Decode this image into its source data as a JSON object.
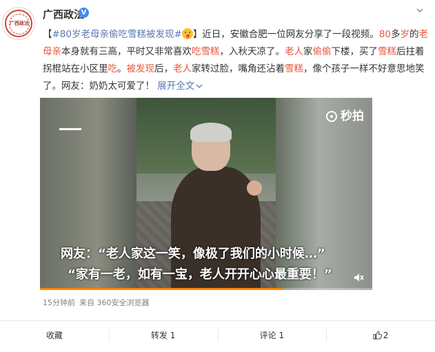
{
  "author": {
    "name": "广西政法",
    "verified": "V",
    "avatar_text": "广西政法"
  },
  "post": {
    "topic": "#80岁老母亲偷吃雪糕被发现#",
    "body_parts": [
      {
        "t": "【",
        "c": ""
      },
      {
        "t": "#80岁老母亲偷吃雪糕被发现#",
        "c": "topic"
      },
      {
        "t": "EMOJI",
        "c": "emoji"
      },
      {
        "t": "】近日，安徽合肥一位网友分享了一段视频。",
        "c": ""
      },
      {
        "t": "80",
        "c": "hl"
      },
      {
        "t": "多",
        "c": ""
      },
      {
        "t": "岁",
        "c": "hl"
      },
      {
        "t": "的",
        "c": ""
      },
      {
        "t": "老母亲",
        "c": "hl"
      },
      {
        "t": "本身就有三高，平时又非常喜欢",
        "c": ""
      },
      {
        "t": "吃雪糕",
        "c": "hl"
      },
      {
        "t": "，入秋天凉了。",
        "c": ""
      },
      {
        "t": "老人",
        "c": "hl"
      },
      {
        "t": "家",
        "c": ""
      },
      {
        "t": "偷偷",
        "c": "hl"
      },
      {
        "t": "下楼，买了",
        "c": ""
      },
      {
        "t": "雪糕",
        "c": "hl"
      },
      {
        "t": "后拄着拐棍站在小区里",
        "c": ""
      },
      {
        "t": "吃",
        "c": "hl"
      },
      {
        "t": "。",
        "c": ""
      },
      {
        "t": "被发现",
        "c": "hl"
      },
      {
        "t": "后，",
        "c": ""
      },
      {
        "t": "老人",
        "c": "hl"
      },
      {
        "t": "家转过脸，嘴角还沾着",
        "c": ""
      },
      {
        "t": "雪糕",
        "c": "hl"
      },
      {
        "t": "，像个孩子一样不好意思地笑了。网友：奶奶太可爱了！ ",
        "c": ""
      }
    ],
    "expand_label": "展开全文",
    "colors": {
      "highlight": "#e8583f",
      "link": "#5d79b3"
    }
  },
  "video": {
    "watermark": "秒拍",
    "caption_line1": "网友：“老人家这一笑，像极了我们的小时候…”",
    "caption_line2": "“家有一老，如有一宝，老人开开心心最重要！”",
    "progress": 0.73,
    "progress_color": "#ff8200"
  },
  "meta": {
    "time": "15分钟前",
    "source": "来自 360安全浏览器"
  },
  "actions": {
    "favorite": "收藏",
    "repost": "转发 1",
    "comment": "评论 1",
    "like": "2"
  }
}
